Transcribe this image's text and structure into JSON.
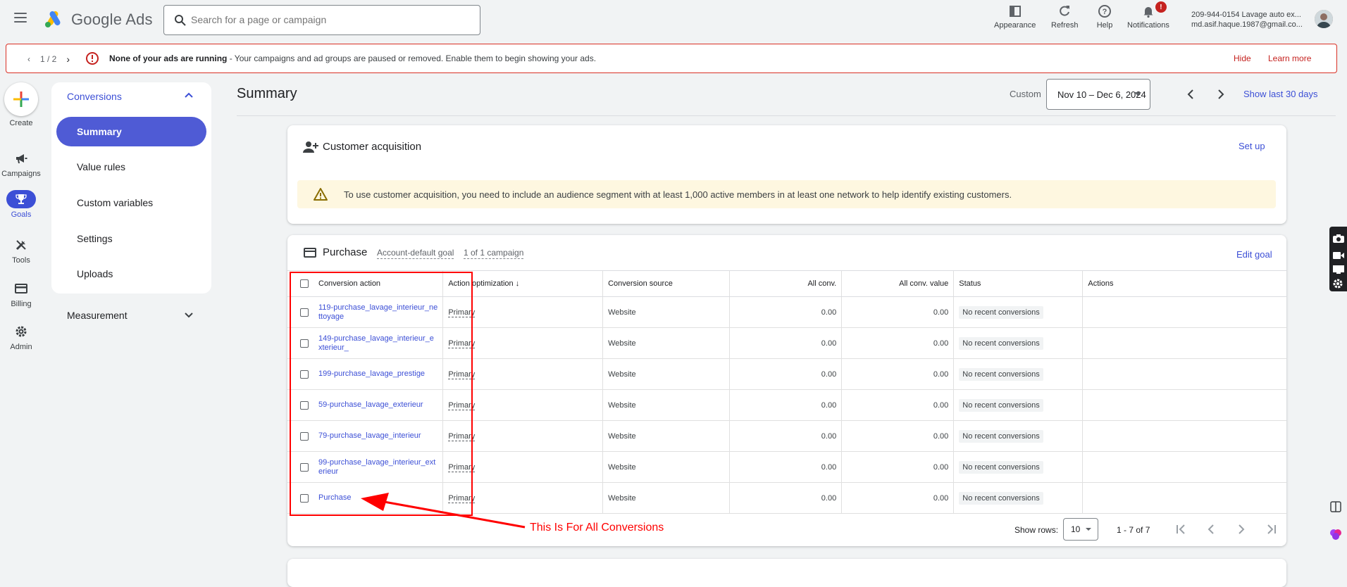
{
  "topbar": {
    "brand": "Google Ads",
    "search_placeholder": "Search for a page or campaign",
    "tools": [
      {
        "label": "Appearance",
        "icon": "appearance-icon"
      },
      {
        "label": "Refresh",
        "icon": "refresh-icon"
      },
      {
        "label": "Help",
        "icon": "help-icon"
      },
      {
        "label": "Notifications",
        "icon": "bell-icon",
        "badge": "!"
      }
    ],
    "account_line1": "209-944-0154 Lavage auto ex...",
    "account_line2": "md.asif.haque.1987@gmail.co..."
  },
  "banner": {
    "pager": "1 / 2",
    "message_bold": "None of your ads are running",
    "message_rest": " - Your campaigns and ad groups are paused or removed. Enable them to begin showing your ads.",
    "hide": "Hide",
    "learn_more": "Learn more"
  },
  "rail": {
    "create": "Create",
    "campaigns": "Campaigns",
    "goals": "Goals",
    "tools": "Tools",
    "billing": "Billing",
    "admin": "Admin"
  },
  "nav": {
    "header": "Conversions",
    "items": [
      "Summary",
      "Value rules",
      "Custom variables",
      "Settings",
      "Uploads"
    ],
    "measurement": "Measurement"
  },
  "header": {
    "title": "Summary",
    "custom_label": "Custom",
    "date_range": "Nov 10 – Dec 6, 2024",
    "show_last": "Show last 30 days"
  },
  "customer_acquisition": {
    "title": "Customer acquisition",
    "setup": "Set up",
    "warning": "To use customer acquisition, you need to include an audience segment with at least 1,000 active members in at least one network to help identify existing customers."
  },
  "purchase": {
    "title": "Purchase",
    "tag_goal": "Account-default goal",
    "tag_campaign": "1 of 1 campaign",
    "edit_goal": "Edit goal",
    "columns": [
      "Conversion action",
      "Action optimization",
      "Conversion source",
      "All conv.",
      "All conv. value",
      "Status",
      "Actions"
    ],
    "rows": [
      {
        "action": "119-purchase_lavage_interieur_nettoyage",
        "optimization": "Primary",
        "source": "Website",
        "conv": "0.00",
        "value": "0.00",
        "status": "No recent conversions"
      },
      {
        "action": "149-purchase_lavage_interieur_exterieur_",
        "optimization": "Primary",
        "source": "Website",
        "conv": "0.00",
        "value": "0.00",
        "status": "No recent conversions"
      },
      {
        "action": "199-purchase_lavage_prestige",
        "optimization": "Primary",
        "source": "Website",
        "conv": "0.00",
        "value": "0.00",
        "status": "No recent conversions"
      },
      {
        "action": "59-purchase_lavage_exterieur",
        "optimization": "Primary",
        "source": "Website",
        "conv": "0.00",
        "value": "0.00",
        "status": "No recent conversions"
      },
      {
        "action": "79-purchase_lavage_interieur",
        "optimization": "Primary",
        "source": "Website",
        "conv": "0.00",
        "value": "0.00",
        "status": "No recent conversions"
      },
      {
        "action": "99-purchase_lavage_interieur_exterieur",
        "optimization": "Primary",
        "source": "Website",
        "conv": "0.00",
        "value": "0.00",
        "status": "No recent conversions"
      },
      {
        "action": "Purchase",
        "optimization": "Primary",
        "source": "Website",
        "conv": "0.00",
        "value": "0.00",
        "status": "No recent conversions"
      }
    ],
    "show_rows_label": "Show rows:",
    "rows_value": "10",
    "range_text": "1 - 7 of 7"
  },
  "annotation": {
    "text": "This Is For All Conversions",
    "color": "#ff0000"
  },
  "colors": {
    "accent": "#3c4fd6",
    "alert": "#d93025",
    "warning_bg": "#fef7e0"
  }
}
